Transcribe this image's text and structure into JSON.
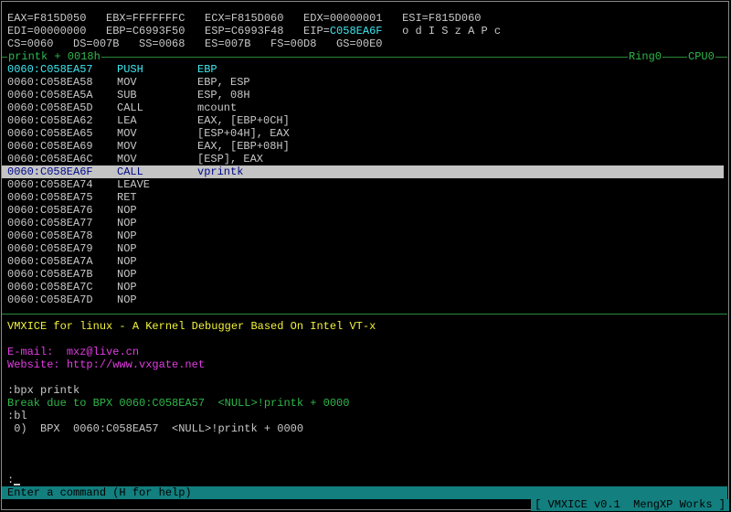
{
  "registers": {
    "line1": "EAX=F815D050   EBX=FFFFFFFC   ECX=F815D060   EDX=00000001   ESI=F815D060",
    "line2_prefix": "EDI=00000000   EBP=C6993F50   ESP=C6993F48   EIP=",
    "eip_value": "C058EA6F",
    "flags": "   o d I S z A P c",
    "line3": "CS=0060   DS=007B   SS=0068   ES=007B   FS=00D8   GS=00E0"
  },
  "code_header": {
    "location": "printk + 0018h",
    "ring": "Ring0",
    "cpu": "CPU0"
  },
  "disasm": [
    {
      "addr": "0060:C058EA57",
      "mn": "PUSH",
      "op": "EBP"
    },
    {
      "addr": "0060:C058EA58",
      "mn": "MOV",
      "op": "EBP, ESP"
    },
    {
      "addr": "0060:C058EA5A",
      "mn": "SUB",
      "op": "ESP, 08H"
    },
    {
      "addr": "0060:C058EA5D",
      "mn": "CALL",
      "op": "mcount"
    },
    {
      "addr": "0060:C058EA62",
      "mn": "LEA",
      "op": "EAX, [EBP+0CH]"
    },
    {
      "addr": "0060:C058EA65",
      "mn": "MOV",
      "op": "[ESP+04H], EAX"
    },
    {
      "addr": "0060:C058EA69",
      "mn": "MOV",
      "op": "EAX, [EBP+08H]"
    },
    {
      "addr": "0060:C058EA6C",
      "mn": "MOV",
      "op": "[ESP], EAX"
    },
    {
      "addr": "0060:C058EA6F",
      "mn": "CALL",
      "op": "vprintk"
    },
    {
      "addr": "0060:C058EA74",
      "mn": "LEAVE",
      "op": ""
    },
    {
      "addr": "0060:C058EA75",
      "mn": "RET",
      "op": ""
    },
    {
      "addr": "0060:C058EA76",
      "mn": "NOP",
      "op": ""
    },
    {
      "addr": "0060:C058EA77",
      "mn": "NOP",
      "op": ""
    },
    {
      "addr": "0060:C058EA78",
      "mn": "NOP",
      "op": ""
    },
    {
      "addr": "0060:C058EA79",
      "mn": "NOP",
      "op": ""
    },
    {
      "addr": "0060:C058EA7A",
      "mn": "NOP",
      "op": ""
    },
    {
      "addr": "0060:C058EA7B",
      "mn": "NOP",
      "op": ""
    },
    {
      "addr": "0060:C058EA7C",
      "mn": "NOP",
      "op": ""
    },
    {
      "addr": "0060:C058EA7D",
      "mn": "NOP",
      "op": ""
    }
  ],
  "console": {
    "banner": "VMXICE for linux - A Kernel Debugger Based On Intel VT-x",
    "email_label": "E-mail:",
    "email_value": "mxz@live.cn",
    "website_label": "Website:",
    "website_value": "http://www.vxgate.net",
    "cmd1": ":bpx printk",
    "msg1": "Break due to BPX 0060:C058EA57  <NULL>!printk + 0000",
    "cmd2": ":bl",
    "bp_list": " 0)  BPX  0060:C058EA57  <NULL>!printk + 0000",
    "prompt": ":"
  },
  "status": {
    "help": "Enter a command (H for help)",
    "brand": "[ VMXICE v0.1  MengXP Works ]"
  }
}
